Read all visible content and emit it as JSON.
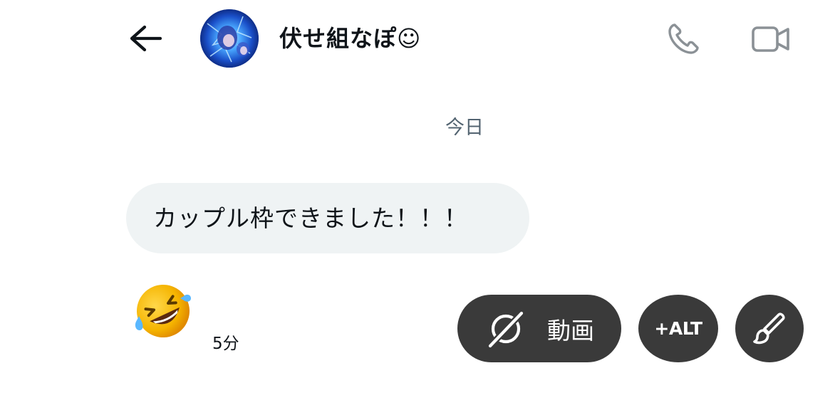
{
  "header": {
    "contact_name": "伏せ組なぽ☺",
    "back_icon": "arrow-left-icon",
    "call_icon": "phone-icon",
    "video_call_icon": "video-camera-icon"
  },
  "conversation": {
    "date_separator": "今日",
    "messages": [
      {
        "text": "カップル枠できました！！！",
        "reaction": "rolling-on-floor-laughing-emoji",
        "time": "5分"
      }
    ]
  },
  "media_toolbar": {
    "video_label": "動画",
    "alt_label": "+ALT",
    "edit_icon": "brush-icon"
  },
  "colors": {
    "bubble_bg": "#eff3f4",
    "pill_bg": "#3a3a3a",
    "muted_text": "#536471",
    "icon_gray": "#8b9196"
  }
}
